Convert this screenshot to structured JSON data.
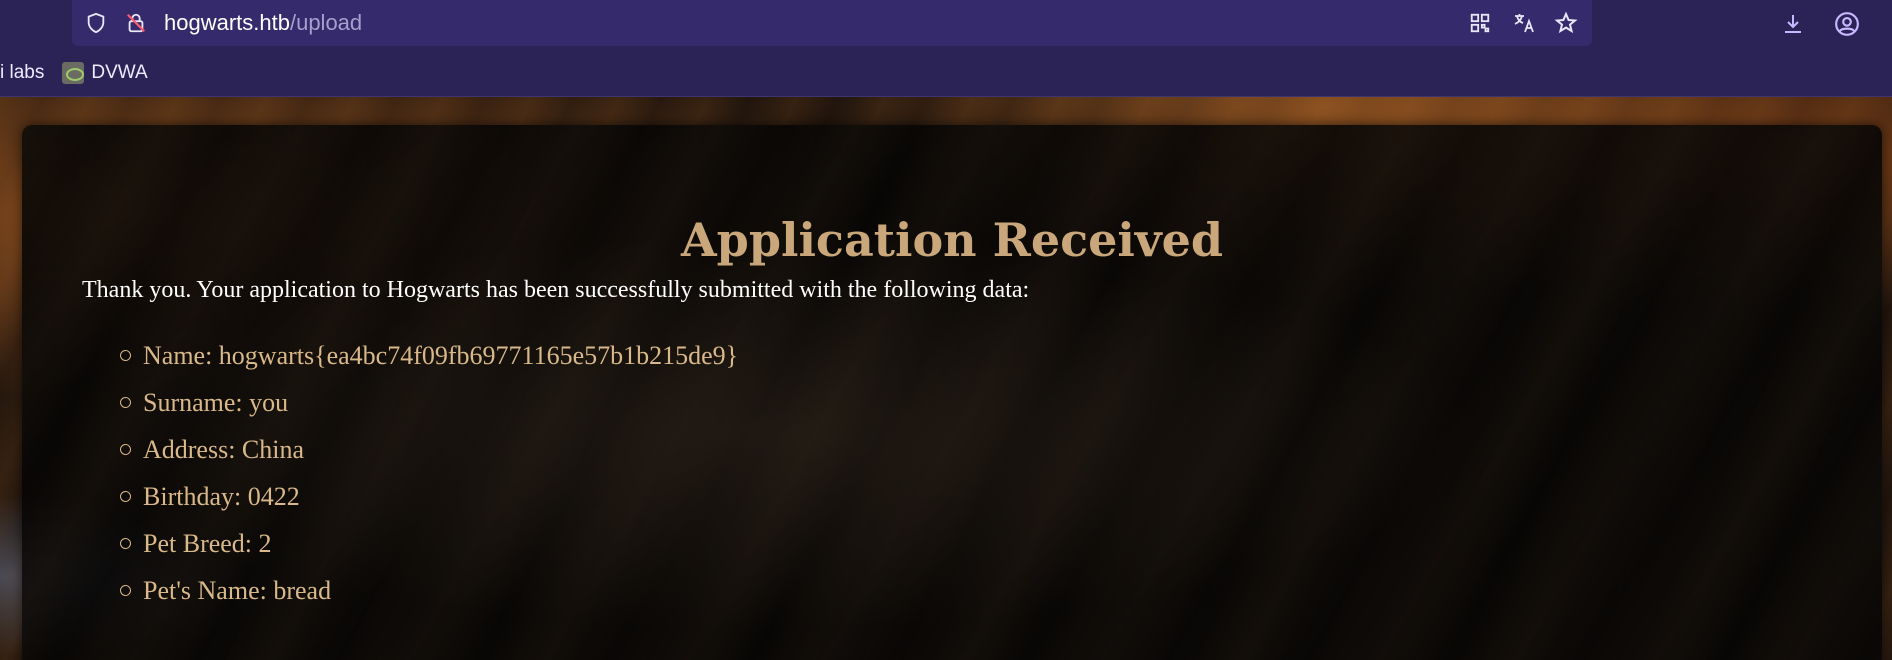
{
  "browser": {
    "url": {
      "host": "hogwarts.htb",
      "path": "/upload"
    },
    "bookmarks": [
      {
        "label": "i labs"
      },
      {
        "label": "DVWA"
      }
    ],
    "icons": {
      "left": [
        "shield-icon",
        "lock-icon"
      ],
      "url_right": [
        "qr-code-icon",
        "translate-icon",
        "star-icon"
      ],
      "toolbar_right": [
        "download-icon",
        "account-icon"
      ]
    },
    "colors": {
      "chrome": "#2b2256",
      "urlbar": "#352a6b"
    }
  },
  "page": {
    "title": "Application Received",
    "intro": "Thank you. Your application to Hogwarts has been successfully submitted with the following data:",
    "fields": [
      "Name: hogwarts{ea4bc74f09fb69771165e57b1b215de9}",
      "Surname: you",
      "Address: China",
      "Birthday: 0422",
      "Pet Breed: 2",
      "Pet's Name: bread"
    ],
    "colors": {
      "accent": "#c9a77a",
      "list_text": "#d9b889",
      "intro_text": "#ffffff"
    }
  }
}
